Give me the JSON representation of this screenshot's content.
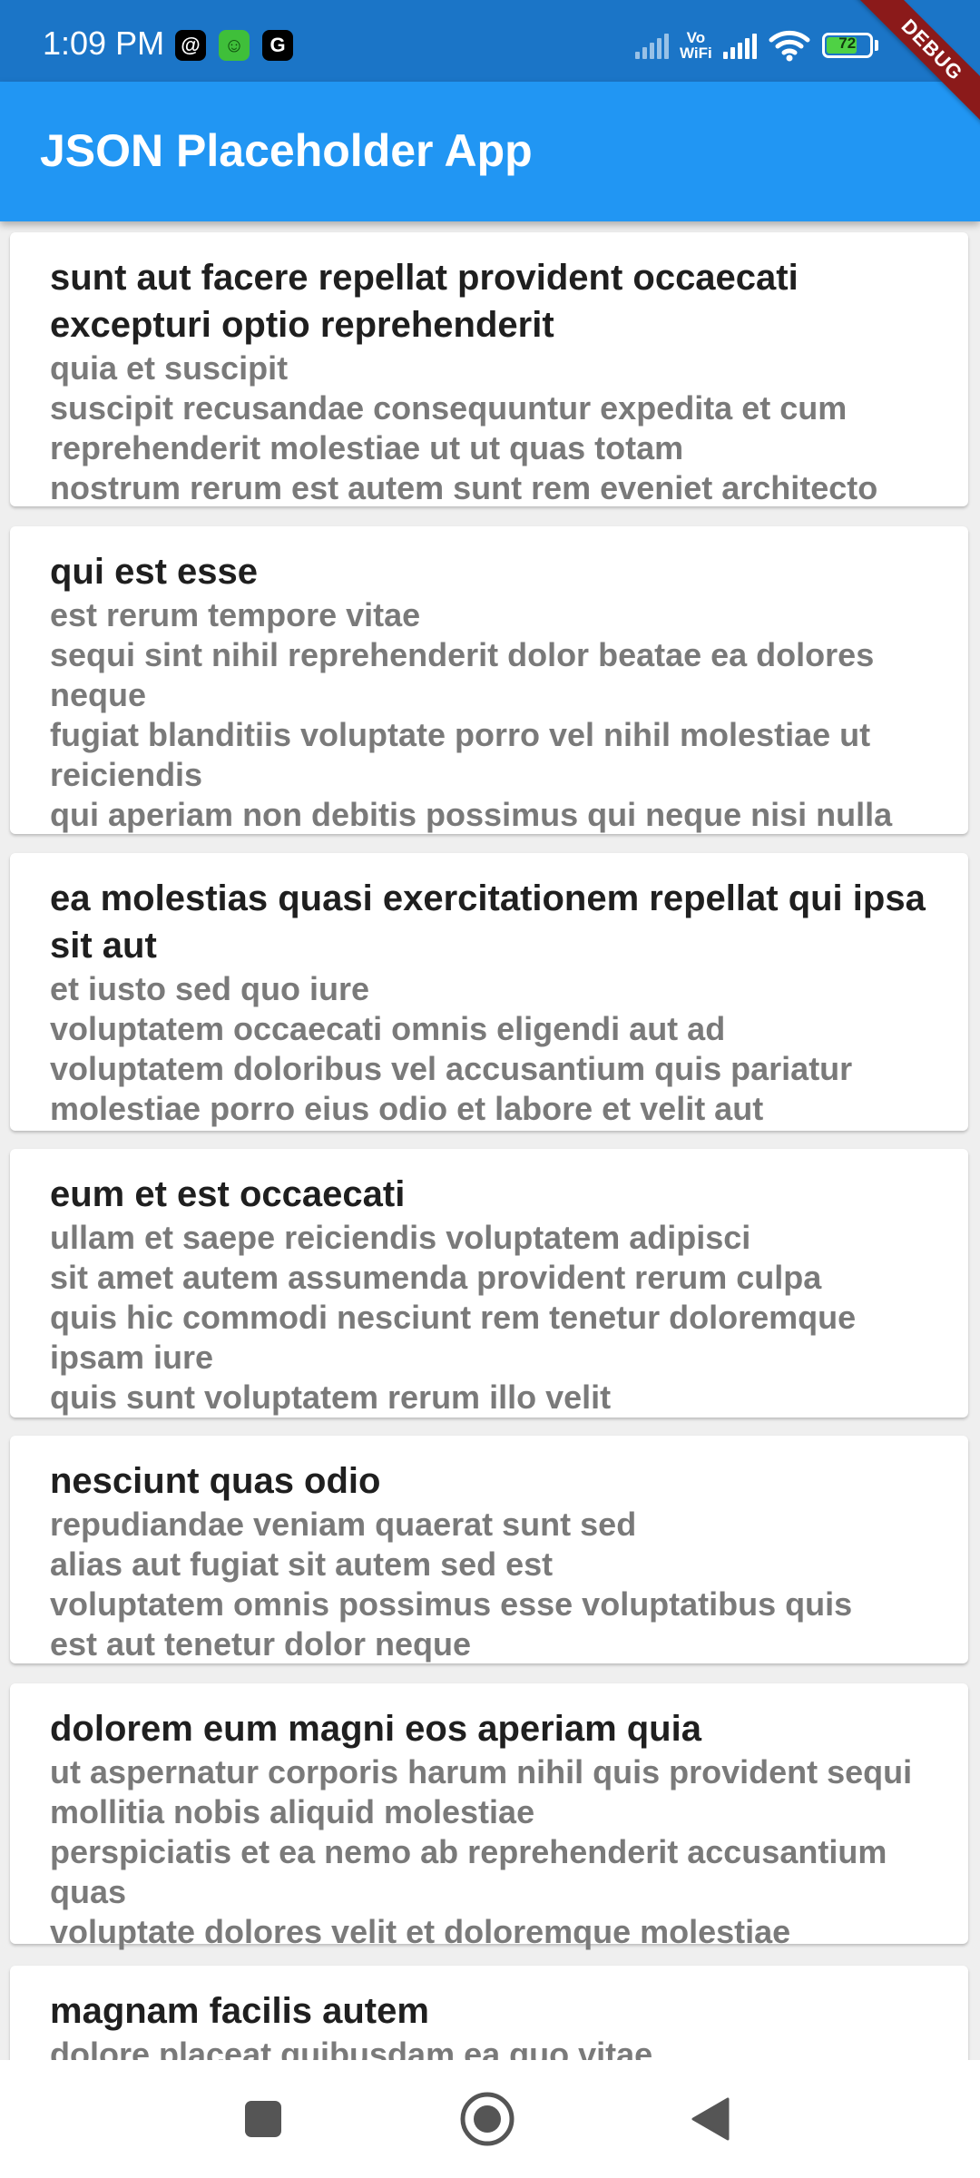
{
  "status_bar": {
    "time": "1:09 PM",
    "notification_icons": [
      "threads-icon",
      "android-robot-icon",
      "google-icon"
    ],
    "vowifi_line1": "Vo",
    "vowifi_line2": "WiFi",
    "battery_level": "72",
    "battery_fraction": 0.72
  },
  "debug_banner": "DEBUG",
  "app_bar": {
    "title": "JSON Placeholder App",
    "color": "#2196f3"
  },
  "posts": [
    {
      "title": "sunt aut facere repellat provident occaecati excepturi optio reprehenderit",
      "body": "quia et suscipit\nsuscipit recusandae consequuntur expedita et cum reprehenderit molestiae ut ut quas totam\nnostrum rerum est autem sunt rem eveniet architecto"
    },
    {
      "title": "qui est esse",
      "body": "est rerum tempore vitae\nsequi sint nihil reprehenderit dolor beatae ea dolores neque\nfugiat blanditiis voluptate porro vel nihil molestiae ut reiciendis\nqui aperiam non debitis possimus qui neque nisi nulla"
    },
    {
      "title": "ea molestias quasi exercitationem repellat qui ipsa sit aut",
      "body": "et iusto sed quo iure\nvoluptatem occaecati omnis eligendi aut ad\nvoluptatem doloribus vel accusantium quis pariatur\nmolestiae porro eius odio et labore et velit aut"
    },
    {
      "title": "eum et est occaecati",
      "body": "ullam et saepe reiciendis voluptatem adipisci\nsit amet autem assumenda provident rerum culpa\nquis hic commodi nesciunt rem tenetur doloremque ipsam iure\nquis sunt voluptatem rerum illo velit"
    },
    {
      "title": "nesciunt quas odio",
      "body": "repudiandae veniam quaerat sunt sed\nalias aut fugiat sit autem sed est\nvoluptatem omnis possimus esse voluptatibus quis\nest aut tenetur dolor neque"
    },
    {
      "title": "dolorem eum magni eos aperiam quia",
      "body": "ut aspernatur corporis harum nihil quis provident sequi\nmollitia nobis aliquid molestiae\nperspiciatis et ea nemo ab reprehenderit accusantium quas\nvoluptate dolores velit et doloremque molestiae"
    },
    {
      "title": "magnam facilis autem",
      "body": "dolore placeat quibusdam ea quo vitae"
    }
  ],
  "nav_bar": {
    "buttons": [
      "recents-square-icon",
      "home-circle-icon",
      "back-triangle-icon"
    ]
  }
}
